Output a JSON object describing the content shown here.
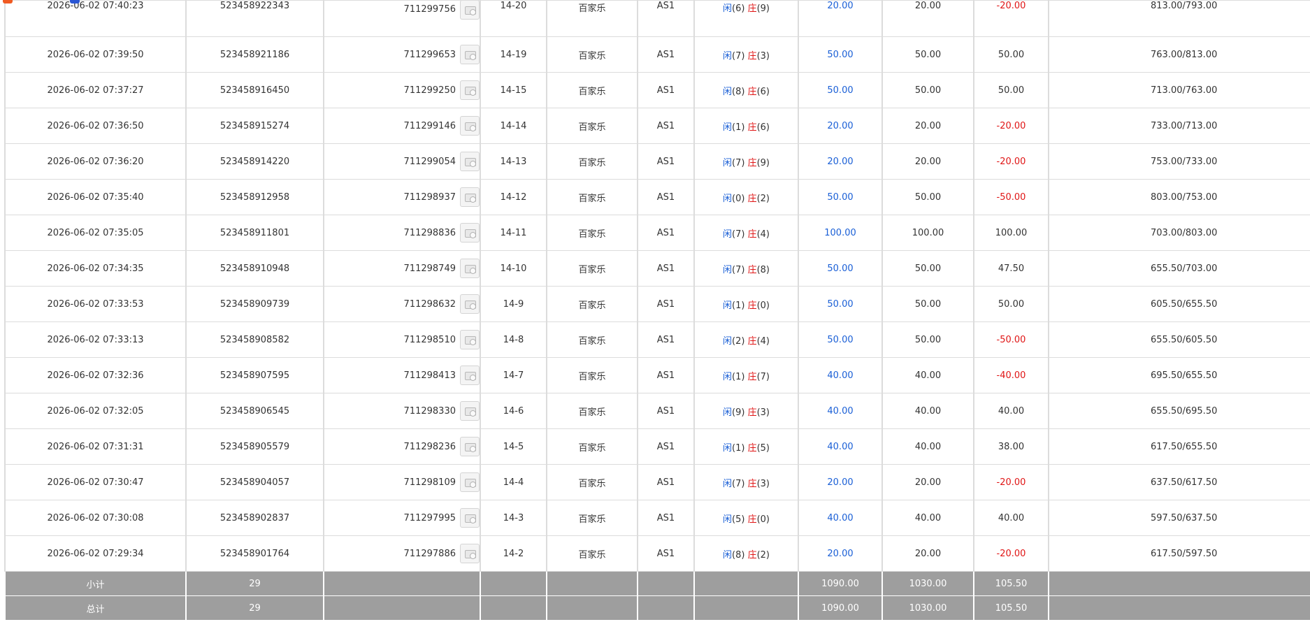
{
  "records": [
    {
      "time": "2026-06-02 07:40:23",
      "bet_no": "523458922343",
      "round": "711299756",
      "shoe": "14-20",
      "game": "百家乐",
      "table": "AS1",
      "player": "(6)",
      "banker": "(9)",
      "bet": "20.00",
      "valid": "20.00",
      "win": "-20.00",
      "win_color": "red",
      "balance": "813.00/793.00"
    },
    {
      "time": "2026-06-02 07:39:50",
      "bet_no": "523458921186",
      "round": "711299653",
      "shoe": "14-19",
      "game": "百家乐",
      "table": "AS1",
      "player": "(7)",
      "banker": "(3)",
      "bet": "50.00",
      "valid": "50.00",
      "win": "50.00",
      "win_color": "black",
      "balance": "763.00/813.00"
    },
    {
      "time": "2026-06-02 07:37:27",
      "bet_no": "523458916450",
      "round": "711299250",
      "shoe": "14-15",
      "game": "百家乐",
      "table": "AS1",
      "player": "(8)",
      "banker": "(6)",
      "bet": "50.00",
      "valid": "50.00",
      "win": "50.00",
      "win_color": "black",
      "balance": "713.00/763.00"
    },
    {
      "time": "2026-06-02 07:36:50",
      "bet_no": "523458915274",
      "round": "711299146",
      "shoe": "14-14",
      "game": "百家乐",
      "table": "AS1",
      "player": "(1)",
      "banker": "(6)",
      "bet": "20.00",
      "valid": "20.00",
      "win": "-20.00",
      "win_color": "red",
      "balance": "733.00/713.00"
    },
    {
      "time": "2026-06-02 07:36:20",
      "bet_no": "523458914220",
      "round": "711299054",
      "shoe": "14-13",
      "game": "百家乐",
      "table": "AS1",
      "player": "(7)",
      "banker": "(9)",
      "bet": "20.00",
      "valid": "20.00",
      "win": "-20.00",
      "win_color": "red",
      "balance": "753.00/733.00"
    },
    {
      "time": "2026-06-02 07:35:40",
      "bet_no": "523458912958",
      "round": "711298937",
      "shoe": "14-12",
      "game": "百家乐",
      "table": "AS1",
      "player": "(0)",
      "banker": "(2)",
      "bet": "50.00",
      "valid": "50.00",
      "win": "-50.00",
      "win_color": "red",
      "balance": "803.00/753.00"
    },
    {
      "time": "2026-06-02 07:35:05",
      "bet_no": "523458911801",
      "round": "711298836",
      "shoe": "14-11",
      "game": "百家乐",
      "table": "AS1",
      "player": "(7)",
      "banker": "(4)",
      "bet": "100.00",
      "valid": "100.00",
      "win": "100.00",
      "win_color": "black",
      "balance": "703.00/803.00"
    },
    {
      "time": "2026-06-02 07:34:35",
      "bet_no": "523458910948",
      "round": "711298749",
      "shoe": "14-10",
      "game": "百家乐",
      "table": "AS1",
      "player": "(7)",
      "banker": "(8)",
      "bet": "50.00",
      "valid": "50.00",
      "win": "47.50",
      "win_color": "black",
      "balance": "655.50/703.00"
    },
    {
      "time": "2026-06-02 07:33:53",
      "bet_no": "523458909739",
      "round": "711298632",
      "shoe": "14-9",
      "game": "百家乐",
      "table": "AS1",
      "player": "(1)",
      "banker": "(0)",
      "bet": "50.00",
      "valid": "50.00",
      "win": "50.00",
      "win_color": "black",
      "balance": "605.50/655.50"
    },
    {
      "time": "2026-06-02 07:33:13",
      "bet_no": "523458908582",
      "round": "711298510",
      "shoe": "14-8",
      "game": "百家乐",
      "table": "AS1",
      "player": "(2)",
      "banker": "(4)",
      "bet": "50.00",
      "valid": "50.00",
      "win": "-50.00",
      "win_color": "red",
      "balance": "655.50/605.50"
    },
    {
      "time": "2026-06-02 07:32:36",
      "bet_no": "523458907595",
      "round": "711298413",
      "shoe": "14-7",
      "game": "百家乐",
      "table": "AS1",
      "player": "(1)",
      "banker": "(7)",
      "bet": "40.00",
      "valid": "40.00",
      "win": "-40.00",
      "win_color": "red",
      "balance": "695.50/655.50"
    },
    {
      "time": "2026-06-02 07:32:05",
      "bet_no": "523458906545",
      "round": "711298330",
      "shoe": "14-6",
      "game": "百家乐",
      "table": "AS1",
      "player": "(9)",
      "banker": "(3)",
      "bet": "40.00",
      "valid": "40.00",
      "win": "40.00",
      "win_color": "black",
      "balance": "655.50/695.50"
    },
    {
      "time": "2026-06-02 07:31:31",
      "bet_no": "523458905579",
      "round": "711298236",
      "shoe": "14-5",
      "game": "百家乐",
      "table": "AS1",
      "player": "(1)",
      "banker": "(5)",
      "bet": "40.00",
      "valid": "40.00",
      "win": "38.00",
      "win_color": "black",
      "balance": "617.50/655.50"
    },
    {
      "time": "2026-06-02 07:30:47",
      "bet_no": "523458904057",
      "round": "711298109",
      "shoe": "14-4",
      "game": "百家乐",
      "table": "AS1",
      "player": "(7)",
      "banker": "(3)",
      "bet": "20.00",
      "valid": "20.00",
      "win": "-20.00",
      "win_color": "red",
      "balance": "637.50/617.50"
    },
    {
      "time": "2026-06-02 07:30:08",
      "bet_no": "523458902837",
      "round": "711297995",
      "shoe": "14-3",
      "game": "百家乐",
      "table": "AS1",
      "player": "(5)",
      "banker": "(0)",
      "bet": "40.00",
      "valid": "40.00",
      "win": "40.00",
      "win_color": "black",
      "balance": "597.50/637.50"
    },
    {
      "time": "2026-06-02 07:29:34",
      "bet_no": "523458901764",
      "round": "711297886",
      "shoe": "14-2",
      "game": "百家乐",
      "table": "AS1",
      "player": "(8)",
      "banker": "(2)",
      "bet": "20.00",
      "valid": "20.00",
      "win": "-20.00",
      "win_color": "red",
      "balance": "617.50/597.50"
    }
  ],
  "player_label": "闲",
  "banker_label": "庄",
  "subtotal": {
    "label": "小计",
    "count": "29",
    "bet": "1090.00",
    "valid": "1030.00",
    "win": "105.50"
  },
  "total": {
    "label": "总计",
    "count": "29",
    "bet": "1090.00",
    "valid": "1030.00",
    "win": "105.50"
  },
  "colors": {
    "player": "#1a5fd6",
    "banker": "#e01515",
    "footer_bg": "#9e9e9e"
  },
  "icons": {
    "round_detail": "card-image-icon"
  }
}
